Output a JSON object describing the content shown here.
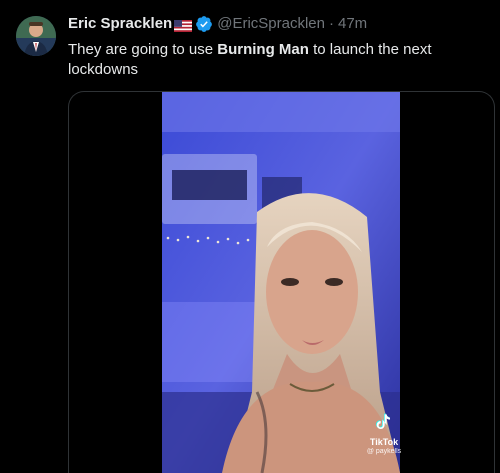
{
  "tweet": {
    "display_name": "Eric Spracklen",
    "handle": "@EricSpracklen",
    "separator": "·",
    "time": "47m",
    "text_before": "They are going to use ",
    "text_bold": "Burning Man",
    "text_after": " to launch the next lockdowns"
  },
  "media": {
    "watermark_brand": "TikTok",
    "watermark_user": "@ paykells"
  },
  "colors": {
    "background": "#000000",
    "text_primary": "#e7e9ea",
    "text_secondary": "#71767b",
    "verified_blue": "#1d9bf0",
    "border": "#2f3336"
  }
}
